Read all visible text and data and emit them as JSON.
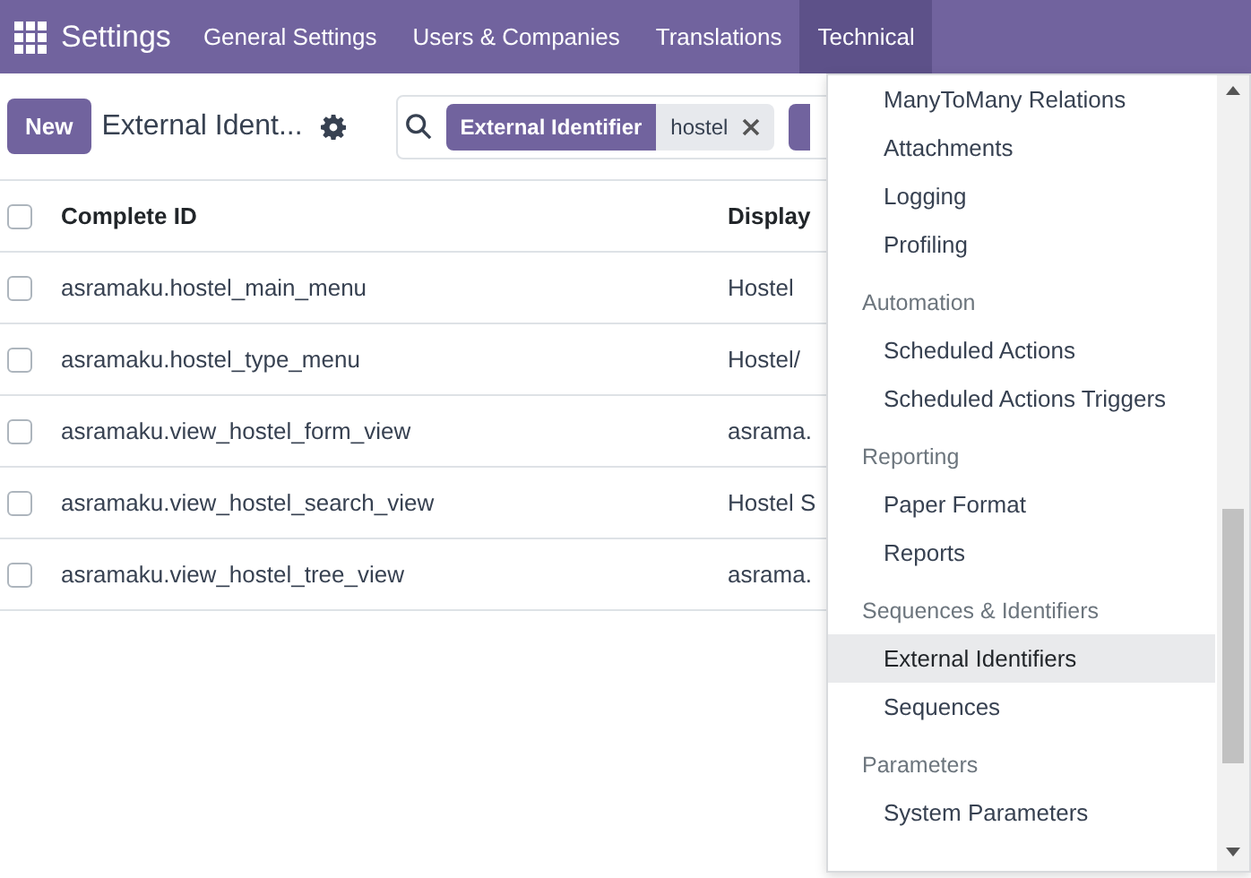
{
  "navbar": {
    "app": "Settings",
    "menus": [
      {
        "label": "General Settings",
        "selected": false
      },
      {
        "label": "Users & Companies",
        "selected": false
      },
      {
        "label": "Translations",
        "selected": false
      },
      {
        "label": "Technical",
        "selected": true
      }
    ]
  },
  "control_panel": {
    "new_button": "New",
    "breadcrumb": "External Ident...",
    "facet": {
      "label": "External Identifier",
      "value": "hostel"
    }
  },
  "table": {
    "checked": false,
    "columns": [
      "Complete ID",
      "Display"
    ],
    "rows": [
      {
        "complete_id": "asramaku.hostel_main_menu",
        "display": "Hostel",
        "checked": false
      },
      {
        "complete_id": "asramaku.hostel_type_menu",
        "display": "Hostel/",
        "checked": false
      },
      {
        "complete_id": "asramaku.view_hostel_form_view",
        "display": "asrama.",
        "checked": false
      },
      {
        "complete_id": "asramaku.view_hostel_search_view",
        "display": "Hostel S",
        "checked": false
      },
      {
        "complete_id": "asramaku.view_hostel_tree_view",
        "display": "asrama.",
        "checked": false
      }
    ]
  },
  "dropdown": {
    "items": [
      {
        "kind": "item",
        "label": "ManyToMany Relations",
        "selected": false
      },
      {
        "kind": "item",
        "label": "Attachments",
        "selected": false
      },
      {
        "kind": "item",
        "label": "Logging",
        "selected": false
      },
      {
        "kind": "item",
        "label": "Profiling",
        "selected": false
      },
      {
        "kind": "header",
        "label": "Automation"
      },
      {
        "kind": "item",
        "label": "Scheduled Actions",
        "selected": false
      },
      {
        "kind": "item",
        "label": "Scheduled Actions Triggers",
        "selected": false
      },
      {
        "kind": "header",
        "label": "Reporting"
      },
      {
        "kind": "item",
        "label": "Paper Format",
        "selected": false
      },
      {
        "kind": "item",
        "label": "Reports",
        "selected": false
      },
      {
        "kind": "header",
        "label": "Sequences & Identifiers"
      },
      {
        "kind": "item",
        "label": "External Identifiers",
        "selected": true
      },
      {
        "kind": "item",
        "label": "Sequences",
        "selected": false
      },
      {
        "kind": "header",
        "label": "Parameters"
      },
      {
        "kind": "item",
        "label": "System Parameters",
        "selected": false
      }
    ]
  }
}
